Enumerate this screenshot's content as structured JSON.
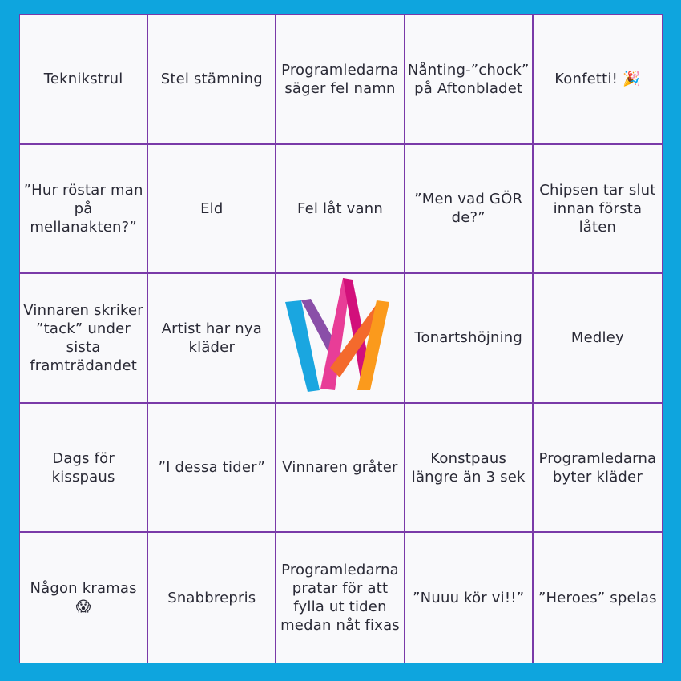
{
  "board": {
    "cells": [
      "Teknikstrul",
      "Stel stämning",
      "Programledarna säger fel namn",
      "Nånting-”chock” på Aftonbladet",
      "Konfetti! 🎉",
      "”Hur röstar man på mellanakten?”",
      "Eld",
      "Fel låt vann",
      "”Men vad GÖR de?”",
      "Chipsen tar slut innan första låten",
      "Vinnaren skriker ”tack” under sista framträdandet",
      "Artist har nya kläder",
      "",
      "Tonartshöjning",
      "Medley",
      "Dags för kisspaus",
      "”I dessa tider”",
      "Vinnaren gråter",
      "Konstpaus längre än 3 sek",
      "Programledarna byter kläder",
      "Någon kramas 😱",
      "Snabbrepris",
      "Programledarna pratar för att fylla ut tiden medan nåt fixas",
      "”Nuuu kör vi!!”",
      "”Heroes” spelas"
    ],
    "center_logo": "melodifestivalen-crown-logo"
  },
  "colors": {
    "background": "#0ea5de",
    "board": "#f9f9fb",
    "grid_lines": "#7a3aa8",
    "text": "#2a2a36"
  }
}
